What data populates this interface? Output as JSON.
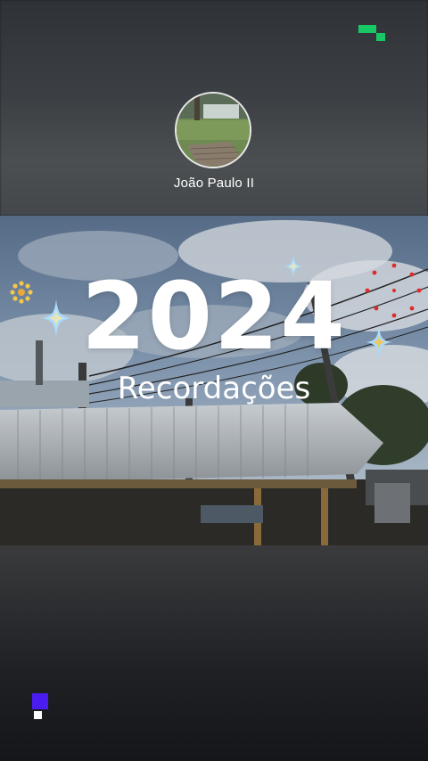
{
  "profile": {
    "name": "João Paulo II"
  },
  "title": {
    "year": "2024",
    "subtitle": "Recordações"
  },
  "colors": {
    "accent_green": "#17c964",
    "accent_purple": "#4b1cf0",
    "sparkle_blue": "#9fd8ff",
    "sparkle_gold": "#f3c64f",
    "dots_red": "#e02a2a"
  },
  "icons": [
    "avatar-photo",
    "sparkle-icon",
    "sun-flower-icon",
    "red-dots-decoration",
    "pixel-logo-icon"
  ]
}
